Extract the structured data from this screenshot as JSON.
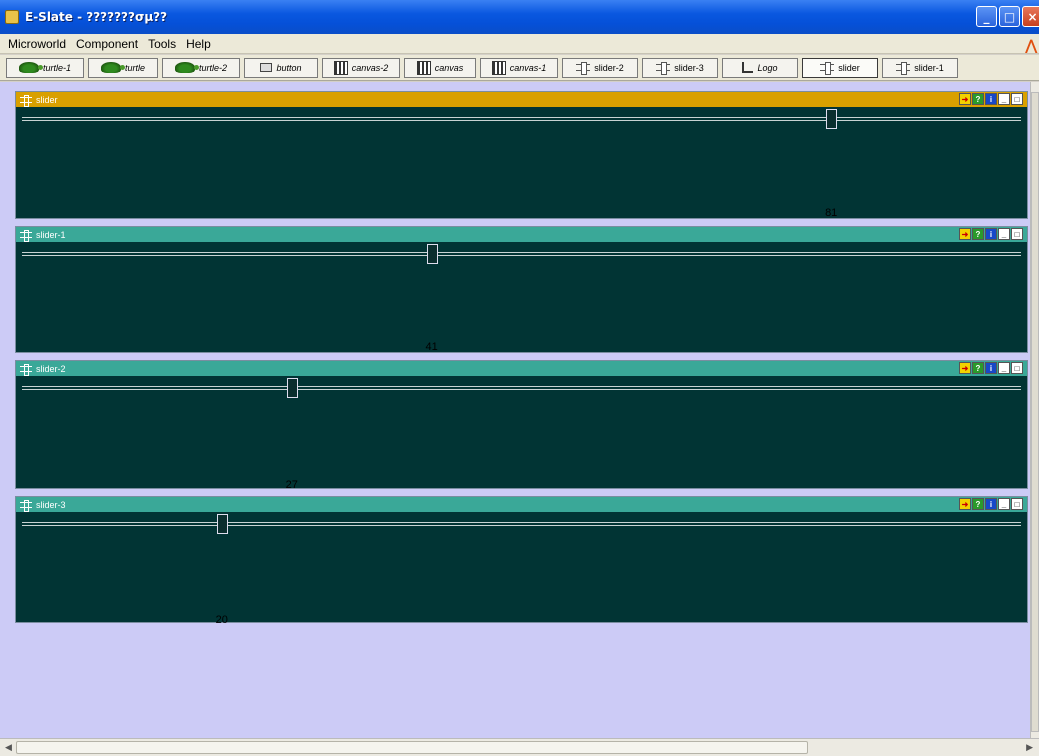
{
  "window": {
    "title": "E-Slate - ???????σμ??",
    "icon": "app-icon",
    "controls": [
      "minimize",
      "maximize",
      "close"
    ]
  },
  "menu": {
    "items": [
      "Microworld",
      "Component",
      "Tools",
      "Help"
    ]
  },
  "toolbar": {
    "buttons": [
      {
        "label": "turtle-1",
        "icon": "turtle-icon",
        "active": false
      },
      {
        "label": "turtle",
        "icon": "turtle-icon",
        "active": false
      },
      {
        "label": "turtle-2",
        "icon": "turtle-icon",
        "active": false
      },
      {
        "label": "button",
        "icon": "button-icon",
        "active": false
      },
      {
        "label": "canvas-2",
        "icon": "canvas-icon",
        "active": false
      },
      {
        "label": "canvas",
        "icon": "canvas-icon",
        "active": false
      },
      {
        "label": "canvas-1",
        "icon": "canvas-icon",
        "active": false
      },
      {
        "label": "slider-2",
        "icon": "slider-icon",
        "active": false
      },
      {
        "label": "slider-3",
        "icon": "slider-icon",
        "active": false
      },
      {
        "label": "Logo",
        "icon": "logo-icon",
        "active": false
      },
      {
        "label": "slider",
        "icon": "slider-icon",
        "active": true
      },
      {
        "label": "slider-1",
        "icon": "slider-icon",
        "active": false
      }
    ]
  },
  "panels": [
    {
      "title": "slider",
      "value": "81",
      "position": 0.81,
      "header_color": "#d9a000"
    },
    {
      "title": "slider-1",
      "value": "41",
      "position": 0.41,
      "header_color": "#3aa898"
    },
    {
      "title": "slider-2",
      "value": "27",
      "position": 0.27,
      "header_color": "#3aa898"
    },
    {
      "title": "slider-3",
      "value": "20",
      "position": 0.2,
      "header_color": "#3aa898"
    }
  ],
  "colors": {
    "desktop": "#cccbf6",
    "panel_body": "#013434"
  }
}
